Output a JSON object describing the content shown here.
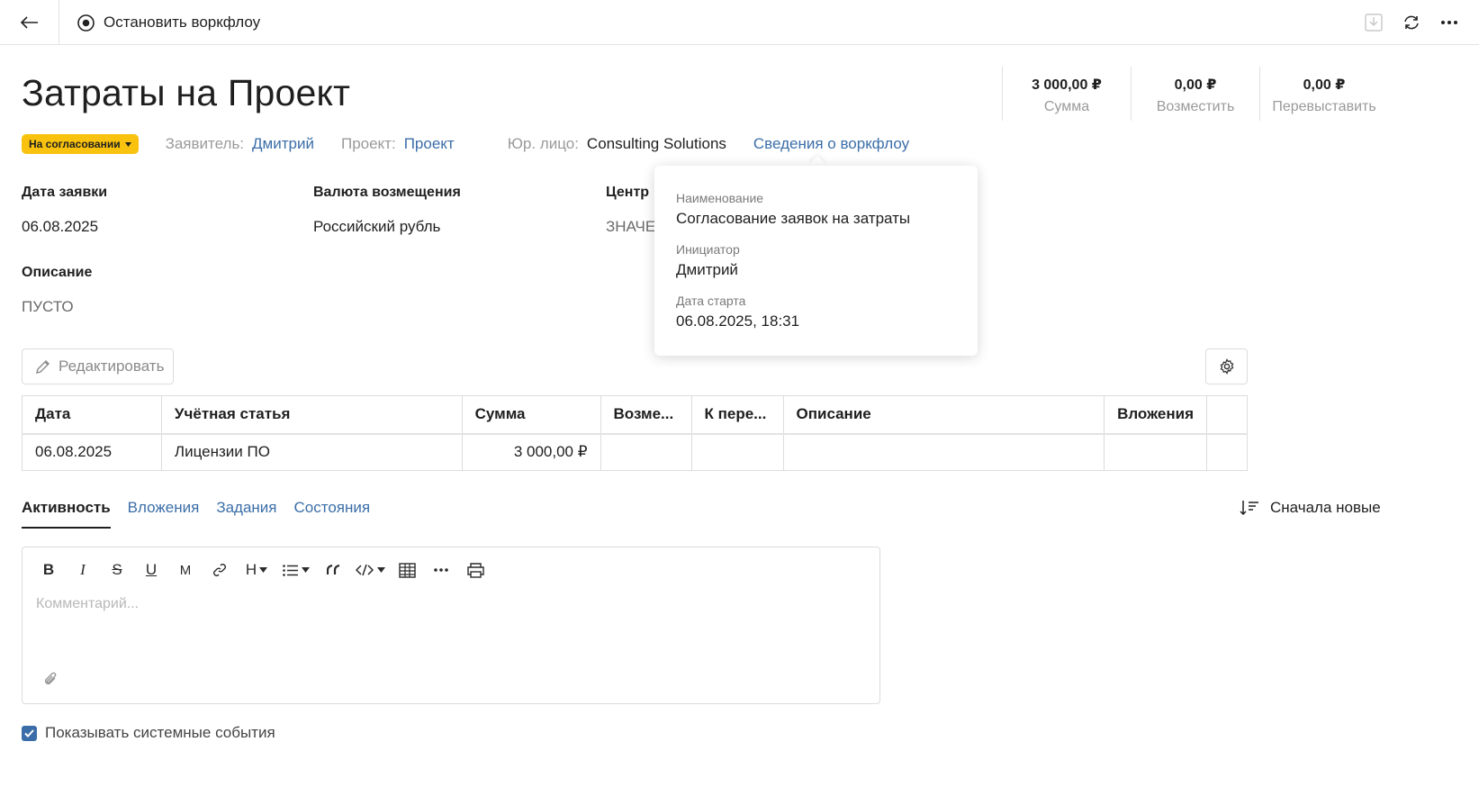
{
  "toolbar": {
    "stop_label": "Остановить воркфлоу"
  },
  "page": {
    "title": "Затраты на Проект"
  },
  "totals": [
    {
      "value": "3 000,00 ₽",
      "label": "Сумма"
    },
    {
      "value": "0,00 ₽",
      "label": "Возместить"
    },
    {
      "value": "0,00 ₽",
      "label": "Перевыставить"
    }
  ],
  "status": {
    "badge": "На согласовании",
    "applicant_label": "Заявитель:",
    "applicant_value": "Дмитрий",
    "project_label": "Проект:",
    "project_value": "Проект",
    "entity_label": "Юр. лицо:",
    "entity_value": "Consulting Solutions",
    "workflow_link": "Сведения о воркфлоу"
  },
  "fields": {
    "date_label": "Дата заявки",
    "date_value": "06.08.2025",
    "currency_label": "Валюта возмещения",
    "currency_value": "Российский рубль",
    "center_label": "Центр",
    "center_value": "ЗНАЧЕ",
    "description_label": "Описание",
    "description_value": "ПУСТО"
  },
  "popover": {
    "name_label": "Наименование",
    "name_value": "Согласование заявок на затраты",
    "initiator_label": "Инициатор",
    "initiator_value": "Дмитрий",
    "start_label": "Дата старта",
    "start_value": "06.08.2025, 18:31"
  },
  "actions": {
    "edit_label": "Редактировать"
  },
  "table": {
    "headers": [
      "Дата",
      "Учётная статья",
      "Сумма",
      "Возме...",
      "К пере...",
      "Описание",
      "Вложения",
      ""
    ],
    "rows": [
      [
        "06.08.2025",
        "Лицензии ПО",
        "3 000,00 ₽",
        "",
        "",
        "",
        "",
        ""
      ]
    ]
  },
  "tabs": [
    {
      "label": "Активность",
      "active": true
    },
    {
      "label": "Вложения",
      "active": false
    },
    {
      "label": "Задания",
      "active": false
    },
    {
      "label": "Состояния",
      "active": false
    }
  ],
  "sort": {
    "label": "Сначала новые"
  },
  "editor": {
    "placeholder": "Комментарий...",
    "tools": [
      "B",
      "I",
      "S",
      "U",
      "M",
      "link",
      "H",
      "list",
      "quote",
      "code",
      "table",
      "more",
      "print"
    ]
  },
  "system_events": {
    "label": "Показывать системные события",
    "checked": true
  },
  "colors": {
    "accent": "#3b6ea8",
    "badge": "#f8c20f",
    "muted": "#9a9a9a"
  }
}
